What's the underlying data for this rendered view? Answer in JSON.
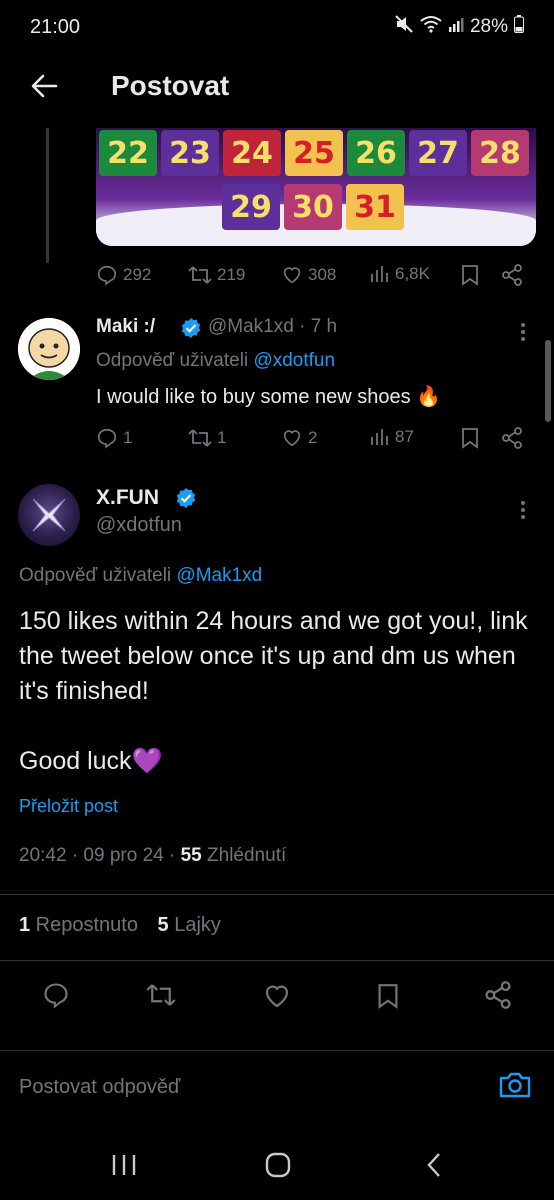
{
  "status_bar": {
    "time": "21:00",
    "battery": "28%"
  },
  "header": {
    "title": "Postovat"
  },
  "calendar": {
    "row1": [
      "22",
      "23",
      "24",
      "25",
      "26",
      "27",
      "28"
    ],
    "row2": [
      "29",
      "30",
      "31"
    ]
  },
  "tweet1_actions": {
    "replies": "292",
    "reposts": "219",
    "likes": "308",
    "views": "6,8K"
  },
  "maki": {
    "name": "Maki :/",
    "handle": "@Mak1xd · 7 h",
    "replying_prefix": "Odpověď uživateli",
    "replying_to": "@xdotfun",
    "text": "I would like to buy some new shoes 🔥",
    "actions": {
      "replies": "1",
      "reposts": "1",
      "likes": "2",
      "views": "87"
    }
  },
  "xfun": {
    "name": "X.FUN",
    "handle": "@xdotfun",
    "replying_prefix": "Odpověď uživateli",
    "replying_to": "@Mak1xd",
    "text": "150 likes within 24 hours and we got you!, link the tweet below once it's up and dm us when it's finished!\n\nGood luck💜",
    "translate": "Přeložit post",
    "time": "20:42 · 09 pro 24 · ",
    "views_count": "55",
    "views_label": " Zhlédnutí",
    "reposts_count": "1",
    "reposts_label": " Repostnuto",
    "likes_count": "5",
    "likes_label": " Lajky"
  },
  "reply": {
    "placeholder": "Postovat odpověď"
  },
  "colors": {
    "accent": "#1d9bf0",
    "verified": "#1d9bf0",
    "muted": "#71767b",
    "background": "#000000"
  },
  "icons": [
    "back-arrow-icon",
    "reply-icon",
    "repost-icon",
    "like-icon",
    "views-icon",
    "bookmark-icon",
    "share-icon",
    "verified-icon",
    "camera-icon",
    "more-icon"
  ]
}
